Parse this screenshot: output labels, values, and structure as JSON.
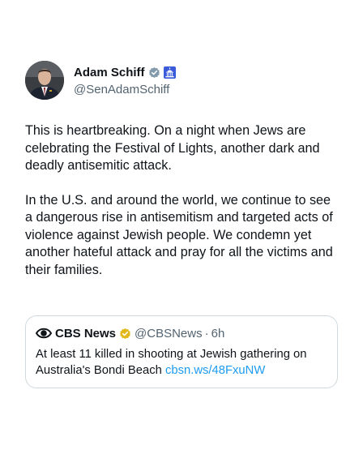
{
  "post": {
    "author": {
      "display_name": "Adam Schiff",
      "handle": "@SenAdamSchiff",
      "avatar_icon": "profile-photo",
      "verified_icon": "verified-gray-badge",
      "affiliation_icon": "us-capitol-badge"
    },
    "paragraphs": [
      "This is heartbreaking. On a night when Jews are celebrating the Festival of Lights, another dark and deadly antisemitic attack.",
      "In the U.S. and around the world, we continue to see a dangerous rise in antisemitism and targeted acts of violence against Jewish people. We condemn yet another hateful attack and pray for all the victims and their families."
    ]
  },
  "quote": {
    "author": {
      "display_name": "CBS News",
      "handle": "@CBSNews",
      "separator": "·",
      "time": "6h",
      "avatar_icon": "cbs-eye-logo",
      "verified_icon": "verified-gold-badge"
    },
    "text": "At least 11 killed in shooting at Jewish gathering on Australia's Bondi Beach",
    "link": "cbsn.ws/48FxuNW"
  },
  "colors": {
    "text": "#0f1419",
    "secondary": "#536471",
    "link": "#1d9bf0",
    "border": "#cfd9de",
    "gray_badge": "#829aab",
    "gold_badge": "#e2b719",
    "capitol_badge": "#3b5bdb"
  }
}
